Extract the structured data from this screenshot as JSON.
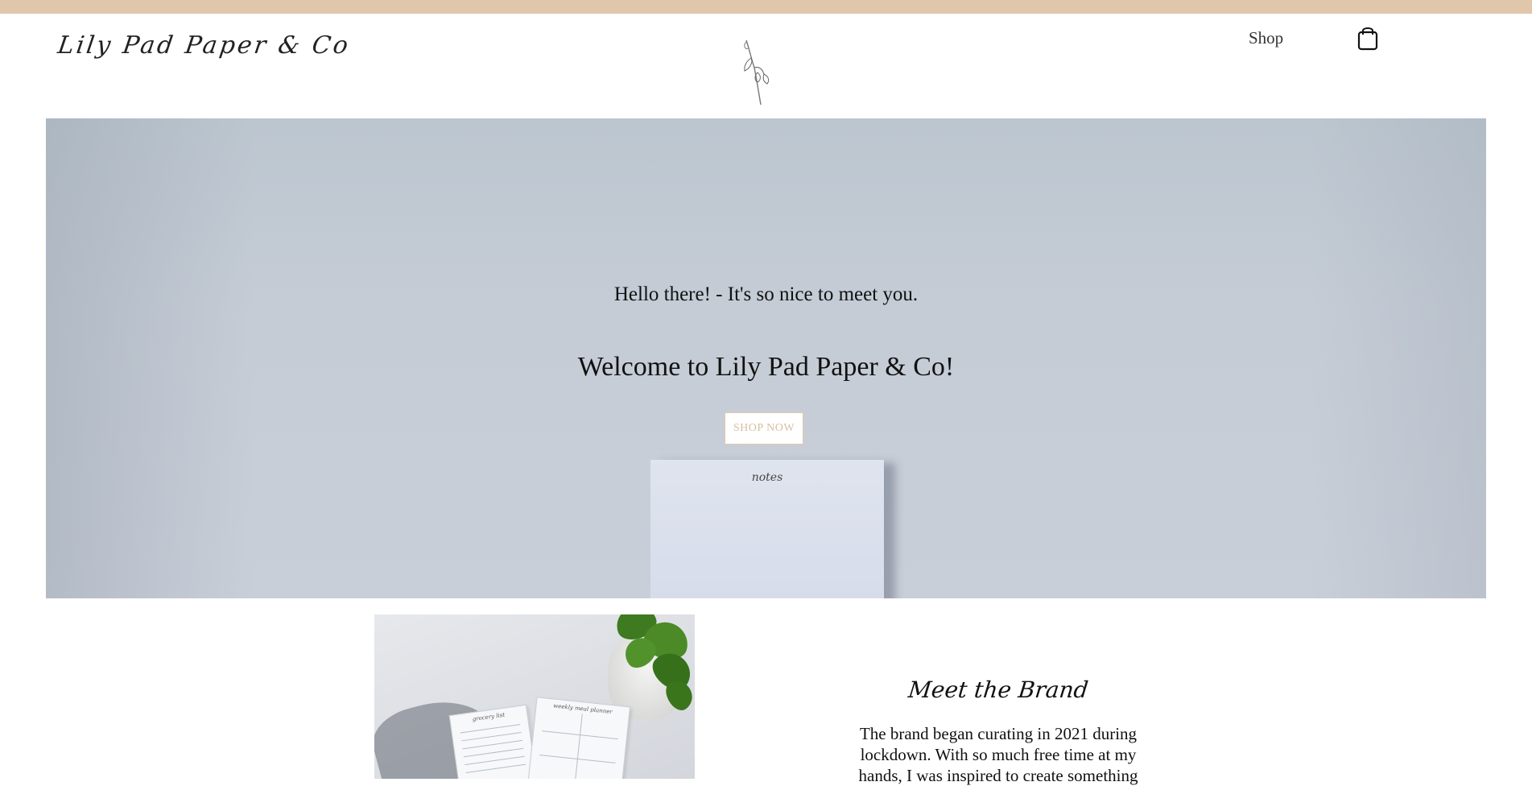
{
  "header": {
    "logo_text": "Lily Pad Paper & Co",
    "nav_shop": "Shop",
    "cart_icon": "shopping-bag-icon",
    "flower_icon": "flower-sketch-icon"
  },
  "hero": {
    "greeting": "Hello there! - It's so nice to meet you.",
    "title": "Welcome to Lily Pad Paper & Co!",
    "cta_label": "SHOP NOW",
    "notepad_label": "notes"
  },
  "about": {
    "photo_card_1_title": "grocery list",
    "photo_card_2_title": "weekly meal planner",
    "title": "Meet the Brand",
    "body": "The brand began curating in 2021 during lockdown. With so much free time at my hands, I was inspired to create something"
  },
  "colors": {
    "accent": "#e0c7ab",
    "hero_bg": "#c5ccd6",
    "text": "#111111"
  }
}
